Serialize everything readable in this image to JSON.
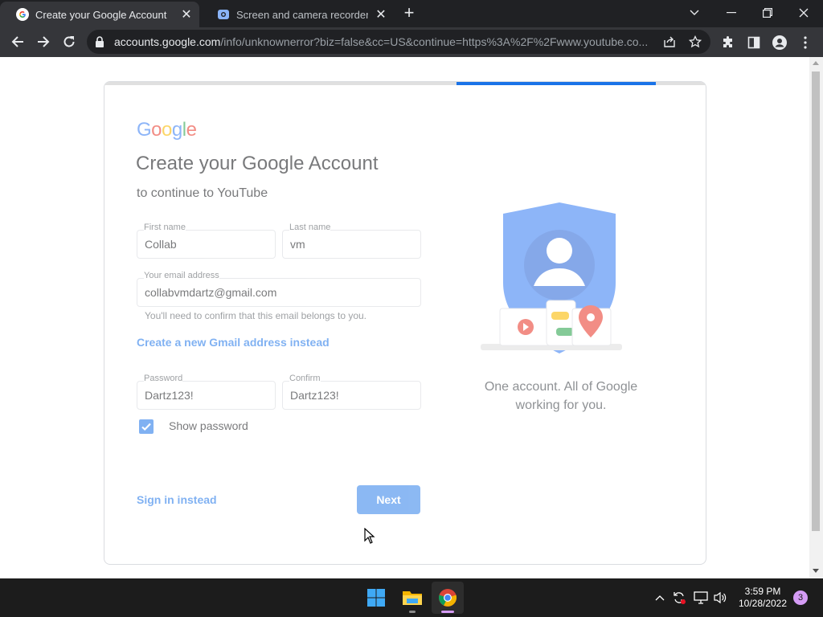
{
  "browser": {
    "tabs": [
      {
        "title": "Create your Google Account",
        "active": true
      },
      {
        "title": "Screen and camera recorder - Sc",
        "active": false
      }
    ],
    "address": {
      "host": "accounts.google.com",
      "path": "/info/unknownerror?biz=false&cc=US&continue=https%3A%2F%2Fwww.youtube.co..."
    }
  },
  "page": {
    "logo": "Google",
    "title": "Create your Google Account",
    "subtitle": "to continue to YouTube",
    "first_name": {
      "label": "First name",
      "value": "Collab"
    },
    "last_name": {
      "label": "Last name",
      "value": "vm"
    },
    "email": {
      "label": "Your email address",
      "value": "collabvmdartz@gmail.com",
      "hint": "You'll need to confirm that this email belongs to you."
    },
    "gmail_link": "Create a new Gmail address instead",
    "password": {
      "label": "Password",
      "value": "Dartz123!"
    },
    "confirm": {
      "label": "Confirm",
      "value": "Dartz123!"
    },
    "show_password": {
      "label": "Show password",
      "checked": true
    },
    "sign_in_link": "Sign in instead",
    "next_button": "Next",
    "tagline_line1": "One account. All of Google",
    "tagline_line2": "working for you.",
    "progress": 0.33
  },
  "taskbar": {
    "time": "3:59 PM",
    "date": "10/28/2022",
    "notifications": "3"
  },
  "colors": {
    "accent": "#1a73e8",
    "chrome_dark": "#202124",
    "chrome_tab": "#35363a",
    "taskbar": "#1c1c1c"
  }
}
